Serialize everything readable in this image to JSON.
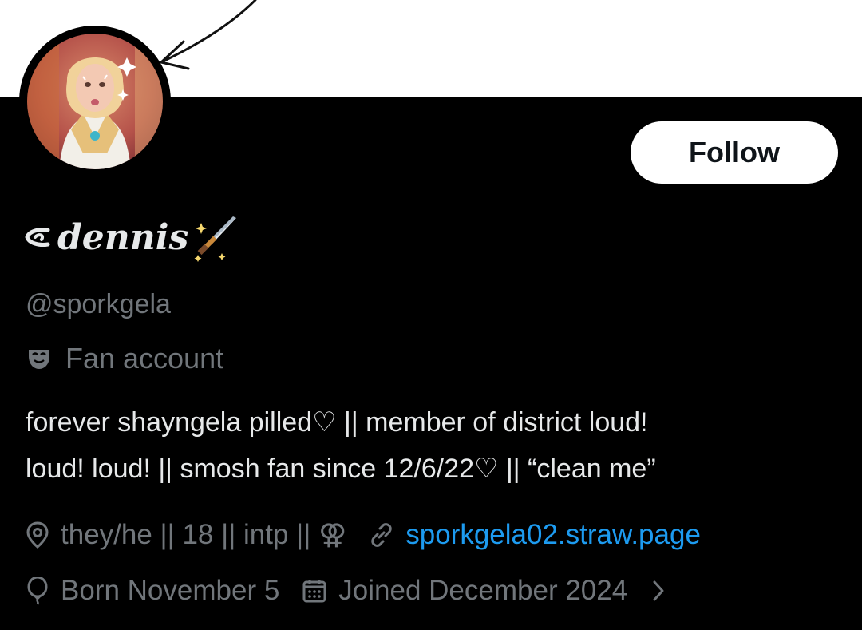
{
  "banner": {
    "color": "#ffffff"
  },
  "profile": {
    "display_name": "dennis",
    "display_name_prefix_icon": "heart-hook-icon",
    "display_name_suffix_icon": "dagger-sparkle-icon",
    "handle": "@sporkgela",
    "category_icon": "theater-masks-icon",
    "category": "Fan account",
    "bio_lines": [
      "forever shayngela pilled♡ || member of district loud!",
      "loud! loud! || smosh fan since 12/6/22♡ || “clean me”"
    ]
  },
  "actions": {
    "follow_label": "Follow"
  },
  "meta": {
    "location_icon": "location-pin-icon",
    "location": "they/he || 18 || intp || ⚢",
    "link_icon": "link-icon",
    "link": "sporkgela02.straw.page",
    "birthday_icon": "balloon-icon",
    "birthday": "Born November 5",
    "joined_icon": "calendar-icon",
    "joined": "Joined December 2024",
    "more_icon": "chevron-right-icon"
  },
  "colors": {
    "background": "#000000",
    "primary_text": "#e7e9ea",
    "secondary_text": "#71767b",
    "link": "#1d9bf0",
    "button_bg": "#ffffff",
    "button_text": "#0f1419"
  }
}
